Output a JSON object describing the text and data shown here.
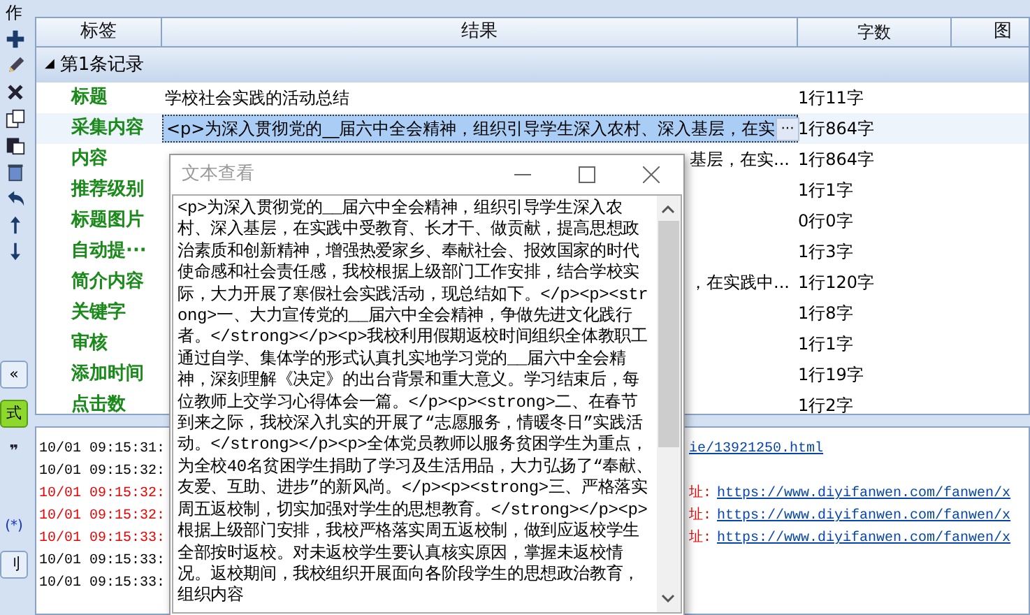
{
  "toolbar": {
    "title": "作"
  },
  "side_buttons": [
    {
      "kind": "collapse",
      "label": "«"
    },
    {
      "kind": "green",
      "label": "式"
    },
    {
      "kind": "icon",
      "label": "❞"
    },
    {
      "kind": "blue",
      "label": "(*)"
    },
    {
      "kind": "plain",
      "label": "刂"
    }
  ],
  "table": {
    "columns": [
      "标签",
      "结果",
      "字数",
      "图"
    ],
    "group": {
      "toggle": "◢",
      "label": "第1条记录",
      "expanded": true
    },
    "rows": [
      {
        "label": "标题",
        "value": "学校社会实践的活动总结",
        "count": "1行11字",
        "selected": false
      },
      {
        "label": "采集内容",
        "value": "<p>为深入贯彻党的__届六中全会精神，组织引导学生深入农村、深入基层，在实",
        "count": "1行864字",
        "selected": true,
        "more": "···"
      },
      {
        "label": "内容",
        "value": "基层，在实...",
        "count": "1行864字",
        "selected": false
      },
      {
        "label": "推荐级别",
        "value": "",
        "count": "1行1字",
        "selected": false
      },
      {
        "label": "标题图片",
        "value": "",
        "count": "0行0字",
        "selected": false
      },
      {
        "label": "自动提···",
        "value": "",
        "count": "1行3字",
        "selected": false
      },
      {
        "label": "简介内容",
        "value": "，在实践中...",
        "count": "1行120字",
        "selected": false
      },
      {
        "label": "关键字",
        "value": "",
        "count": "1行8字",
        "selected": false
      },
      {
        "label": "审核",
        "value": "",
        "count": "1行1字",
        "selected": false
      },
      {
        "label": "添加时间",
        "value": "",
        "count": "1行19字",
        "selected": false
      },
      {
        "label": "点击数",
        "value": "",
        "count": "1行2字",
        "selected": false
      }
    ]
  },
  "log": [
    {
      "time": "10/01 09:15:31:",
      "kind": "info",
      "link": "ie/13921250.html"
    },
    {
      "time": "10/01 09:15:32:",
      "kind": "info"
    },
    {
      "time": "10/01 09:15:32:",
      "kind": "error",
      "tag": "址:",
      "link": "https://www.diyifanwen.com/fanwen/x"
    },
    {
      "time": "10/01 09:15:32:",
      "kind": "error",
      "tag": "址:",
      "link": "https://www.diyifanwen.com/fanwen/x"
    },
    {
      "time": "10/01 09:15:33:",
      "kind": "error",
      "tag": "址:",
      "link": "https://www.diyifanwen.com/fanwen/x"
    },
    {
      "time": "10/01 09:15:33:",
      "kind": "info"
    },
    {
      "time": "10/01 09:15:33:",
      "kind": "info"
    }
  ],
  "dialog": {
    "title": "文本查看",
    "text": "<p>为深入贯彻党的__届六中全会精神，组织引导学生深入农村、深入基层，在实践中受教育、长才干、做贡献，提高思想政治素质和创新精神，增强热爱家乡、奉献社会、报效国家的时代使命感和社会责任感，我校根据上级部门工作安排，结合学校实际，大力开展了寒假社会实践活动，现总结如下。</p><p><strong>一、大力宣传党的__届六中全会精神，争做先进文化践行者。</strong></p><p>我校利用假期返校时间组织全体教职工通过自学、集体学的形式认真扎实地学习党的__届六中全会精神，深刻理解《决定》的出台背景和重大意义。学习结束后，每位教师上交学习心得体会一篇。</p><p><strong>二、在春节到来之际，我校深入扎实的开展了“志愿服务，情暖冬日”实践活动。</strong></p><p>全体党员教师以服务贫困学生为重点，为全校40名贫困学生捐助了学习及生活用品，大力弘扬了“奉献、友爱、互助、进步”的新风尚。</p><p><strong>三、严格落实周五返校制，切实加强对学生的思想教育。</strong></p><p>根据上级部门安排，我校严格落实周五返校制，做到应返校学生全部按时返校。对未返校学生要认真核实原因，掌握未返校情况。返校期间，我校组织开展面向各阶段学生的思想政治教育，组织内容"
  }
}
